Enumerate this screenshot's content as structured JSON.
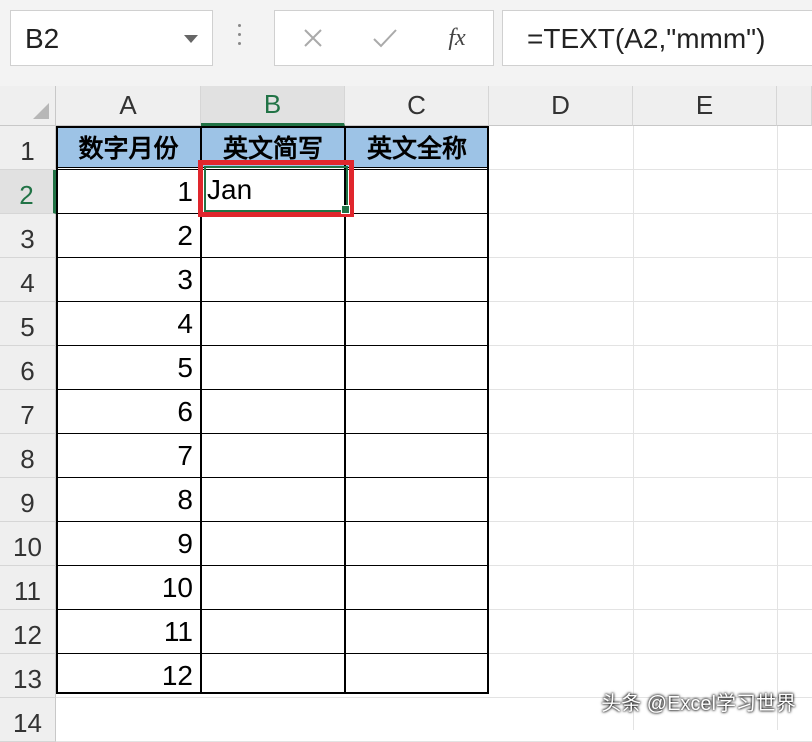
{
  "formula_bar": {
    "name_box": "B2",
    "cancel_icon": "close-icon",
    "enter_icon": "check-icon",
    "fx_label": "fx",
    "formula": "=TEXT(A2,\"mmm\")"
  },
  "columns": [
    "A",
    "B",
    "C",
    "D",
    "E"
  ],
  "rows": [
    "1",
    "2",
    "3",
    "4",
    "5",
    "6",
    "7",
    "8",
    "9",
    "10",
    "11",
    "12",
    "13",
    "14"
  ],
  "table": {
    "headers": [
      "数字月份",
      "英文简写",
      "英文全称"
    ],
    "a_values": [
      "1",
      "2",
      "3",
      "4",
      "5",
      "6",
      "7",
      "8",
      "9",
      "10",
      "11",
      "12"
    ],
    "b2_value": "Jan"
  },
  "watermark": "头条 @Excel学习世界",
  "colors": {
    "header_fill": "#9dc3e6",
    "selection": "#217346",
    "highlight": "#e0262d"
  }
}
